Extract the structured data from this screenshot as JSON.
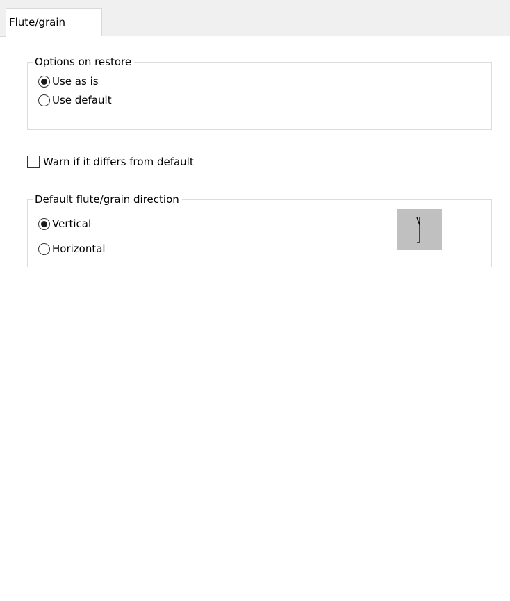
{
  "tabs": [
    {
      "label": "Flute/grain",
      "active": true
    }
  ],
  "options_on_restore": {
    "legend": "Options on restore",
    "options": [
      {
        "label": "Use as is",
        "checked": true
      },
      {
        "label": "Use default",
        "checked": false
      }
    ]
  },
  "warn_checkbox": {
    "label": "Warn if it differs from default",
    "checked": false
  },
  "default_direction": {
    "legend": "Default flute/grain direction",
    "options": [
      {
        "label": "Vertical",
        "checked": true
      },
      {
        "label": "Horizontal",
        "checked": false
      }
    ],
    "preview_icon": "vertical-grain-arrow-icon"
  },
  "colors": {
    "tabstrip_bg": "#f0f0f0",
    "border": "#dcdcdc",
    "preview_bg": "#c0c0c0"
  }
}
